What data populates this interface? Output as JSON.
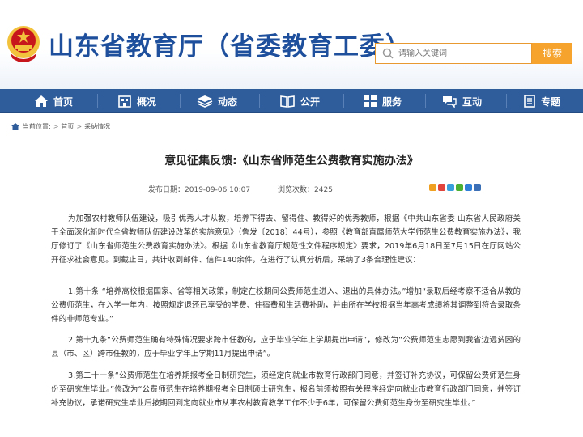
{
  "header": {
    "site_title": "山东省教育厅（省委教育工委）",
    "search_placeholder": "请输入关键词",
    "search_button": "搜索"
  },
  "nav": {
    "items": [
      {
        "label": "首页",
        "icon": "home-icon"
      },
      {
        "label": "概况",
        "icon": "building-icon"
      },
      {
        "label": "动态",
        "icon": "stack-icon"
      },
      {
        "label": "公开",
        "icon": "book-icon"
      },
      {
        "label": "服务",
        "icon": "grid-icon"
      },
      {
        "label": "互动",
        "icon": "chat-icon"
      },
      {
        "label": "专题",
        "icon": "document-icon"
      }
    ]
  },
  "breadcrumb": {
    "prefix": "当前位置:",
    "items": [
      "首页",
      "采纳情况"
    ]
  },
  "article": {
    "title": "意见征集反馈:《山东省师范生公费教育实施办法》",
    "published_label": "发布日期：",
    "published_value": "2019-09-06 10:07",
    "views_label": "浏览次数：",
    "views_value": "2425",
    "paragraphs": [
      "为加强农村教师队伍建设，吸引优秀人才从教，培养下得去、留得住、教得好的优秀教师，根据《中共山东省委 山东省人民政府关于全面深化新时代全省教师队伍建设改革的实施意见》（鲁发〔2018〕44号），参照《教育部直属师范大学师范生公费教育实施办法》，我厅修订了《山东省师范生公费教育实施办法》。根据《山东省教育厅规范性文件程序规定》要求，2019年6月18日至7月15日在厅网站公开征求社会意见。到截止日，共计收到邮件、信件140余件，在进行了认真分析后，采纳了3条合理性建议：",
      "1.第十条 “培养高校根据国家、省等相关政策，制定在校期间公费师范生进入、退出的具体办法。”增加“录取后经考察不适合从教的公费师范生，在入学一年内，按照规定退还已享受的学费、住宿费和生活费补助，并由所在学校根据当年高考成绩将其调整到符合录取条件的非师范专业。”",
      "2.第十九条“公费师范生确有特殊情况要求跨市任教的，应于毕业学年上学期提出申请”，修改为“公费师范生志愿到我省边远贫困的县（市、区）跨市任教的，应于毕业学年上学期11月提出申请”。",
      "3.第二十一条“公费师范生在培养期报考全日制研究生，须经定向就业市教育行政部门同意，并签订补充协议，可保留公费师范生身份至研究生毕业。”修改为“公费师范生在培养期报考全日制硕士研究生，报名前须按照有关程序经定向就业市教育行政部门同意，并签订补充协议，承诺研究生毕业后按期回到定向就业市从事农村教育教学工作不少于6年，可保留公费师范生身份至研究生毕业。”"
    ]
  },
  "colors": {
    "brand_blue": "#1e4f9c",
    "nav_bg": "#2f5d9c",
    "search_accent": "#f5a32c",
    "emblem_red": "#c8161d",
    "emblem_gold": "#f3c23c"
  }
}
